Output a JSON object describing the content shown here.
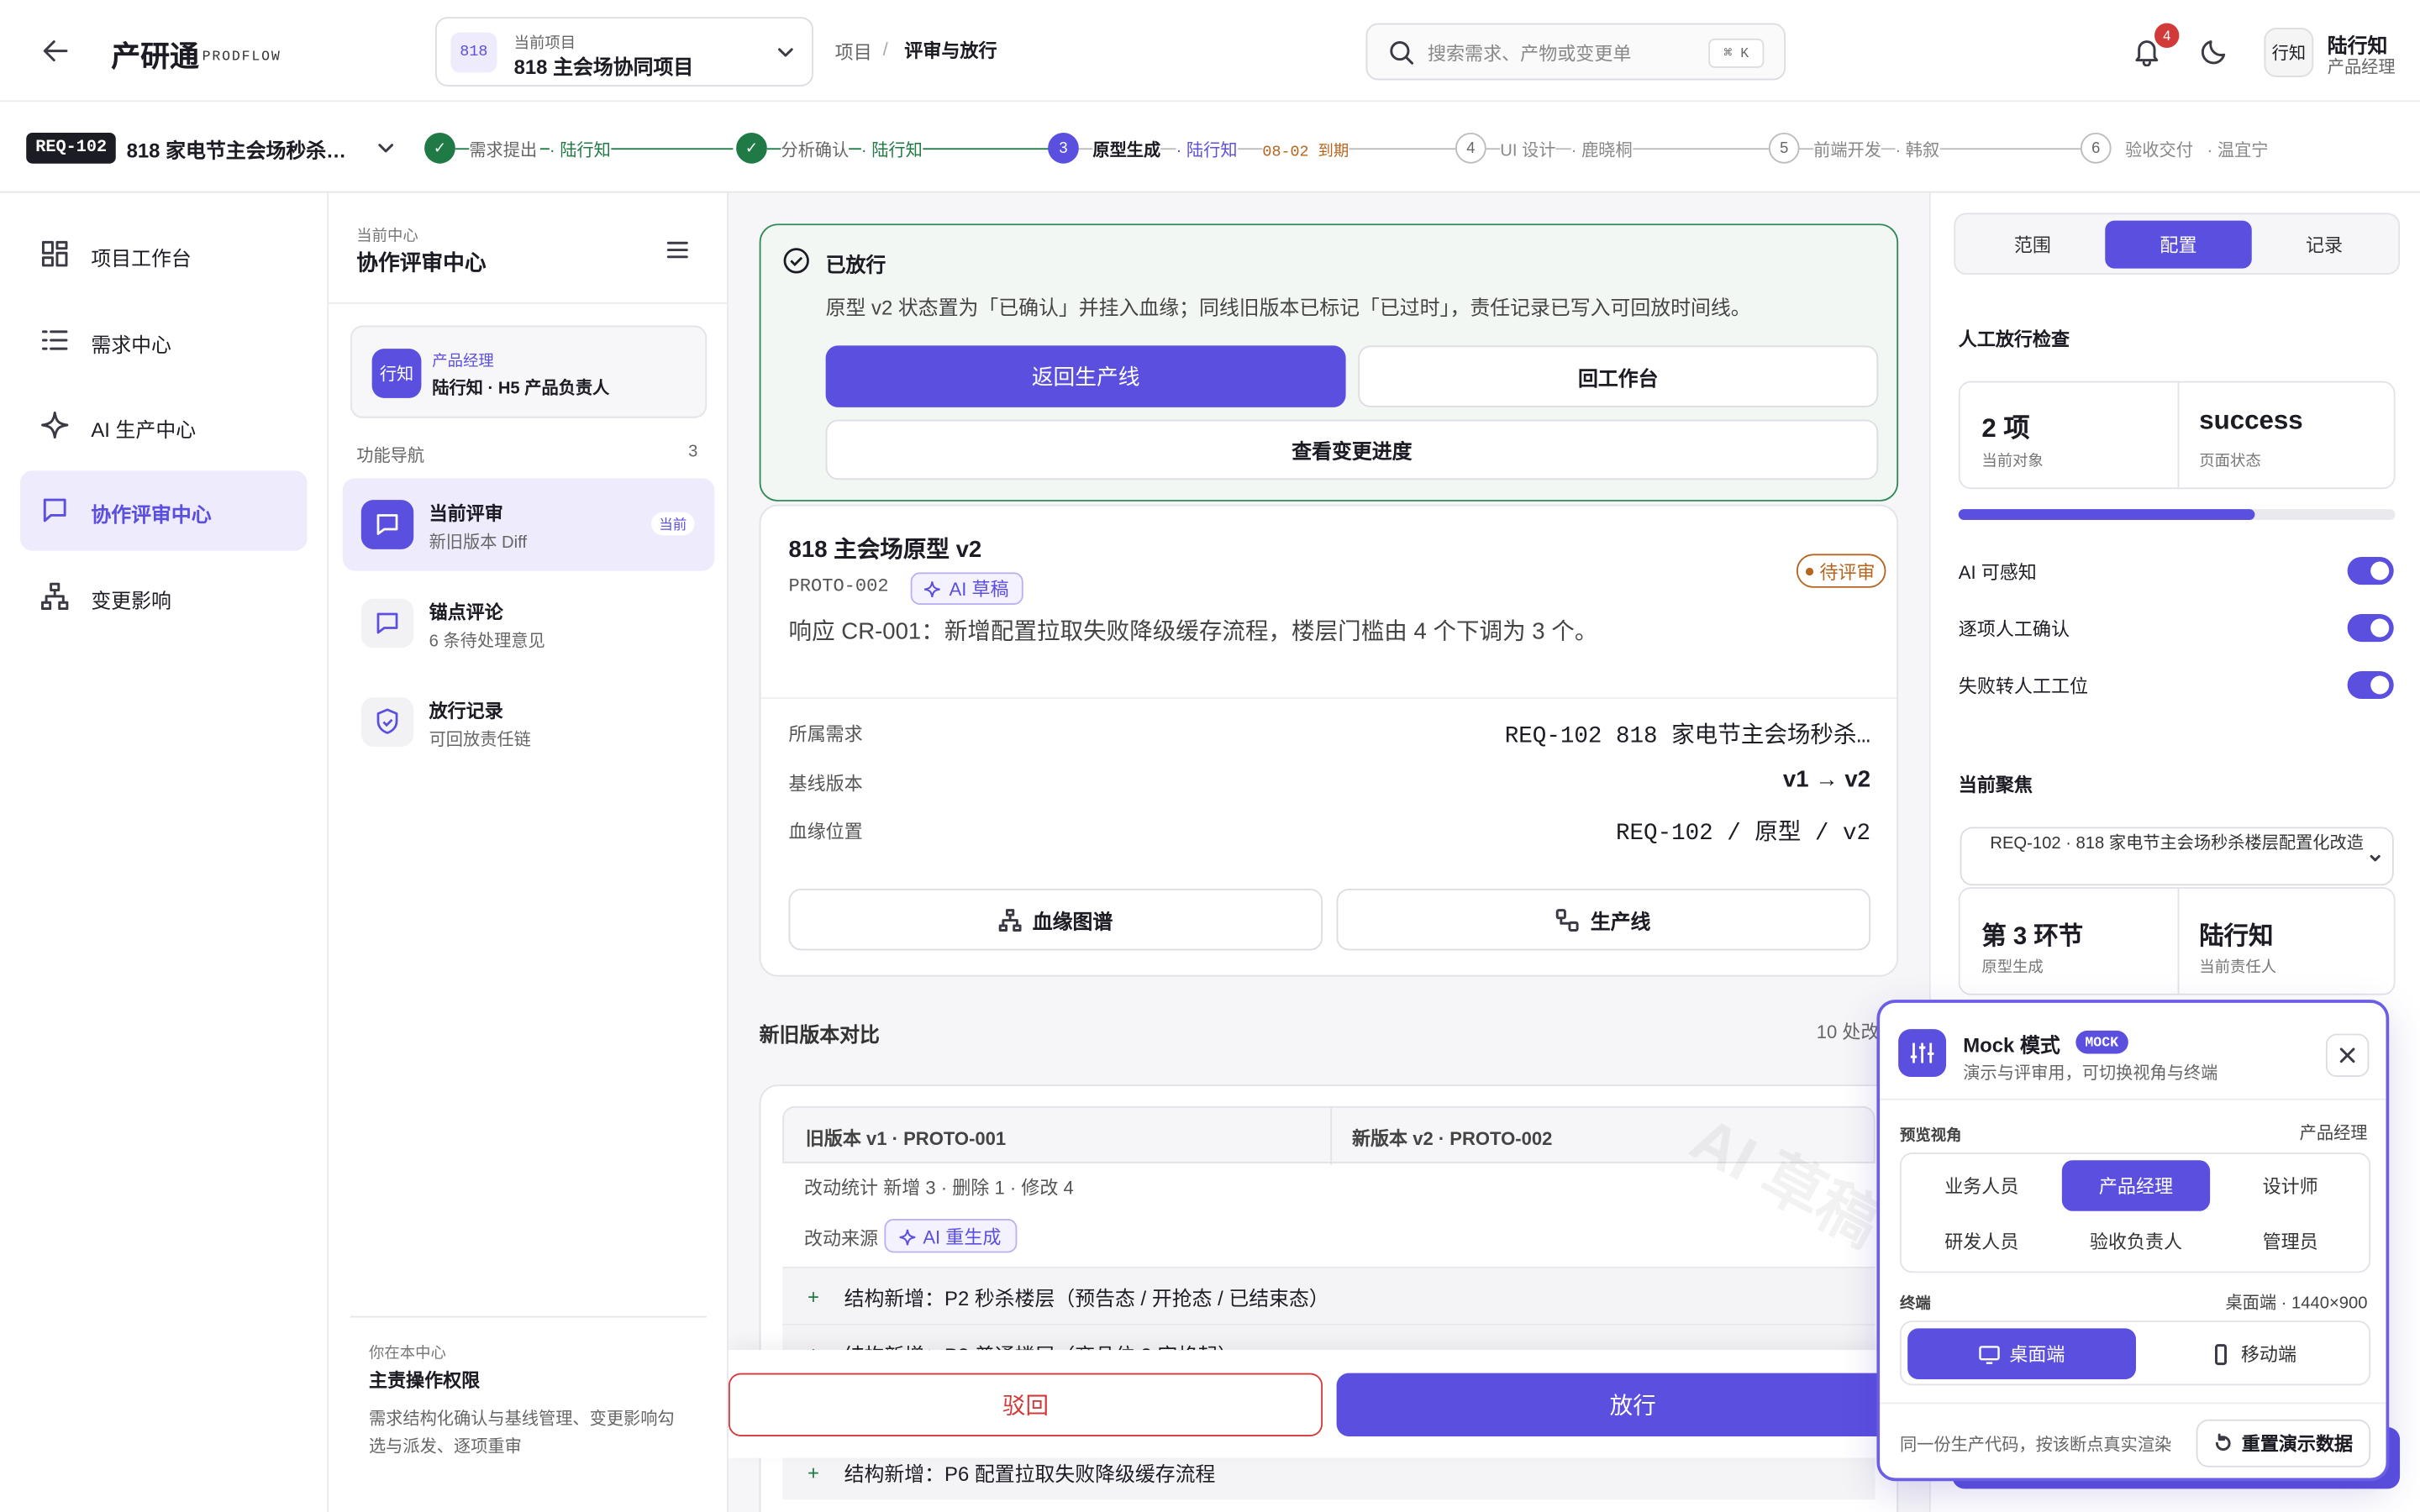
{
  "header": {
    "app_name": "产研通",
    "app_sub": "PRODFLOW",
    "project_badge": "818",
    "project_caption": "当前项目",
    "project_name": "818 主会场协同项目",
    "crumb_project": "项目",
    "crumb_sep": "/",
    "crumb_current": "评审与放行",
    "search_placeholder": "搜索需求、产物或变更单",
    "search_kbd": "⌘ K",
    "notif_count": "4",
    "avatar": "行知",
    "user_name": "陆行知",
    "user_role": "产品经理"
  },
  "stepbar": {
    "req_id": "REQ-102",
    "req_title": "818 家电节主会场秒杀…",
    "steps": [
      {
        "num": "✓",
        "name": "需求提出",
        "owner": "· 陆行知",
        "state": "done"
      },
      {
        "num": "✓",
        "name": "分析确认",
        "owner": "· 陆行知",
        "state": "done"
      },
      {
        "num": "3",
        "name": "原型生成",
        "owner": "· 陆行知",
        "due": "08-02 到期",
        "state": "current"
      },
      {
        "num": "4",
        "name": "UI 设计",
        "owner": "· 鹿晓桐",
        "state": "todo"
      },
      {
        "num": "5",
        "name": "前端开发",
        "owner": "· 韩叙",
        "state": "todo"
      },
      {
        "num": "6",
        "name": "验收交付",
        "owner": "· 温宜宁",
        "state": "todo"
      }
    ]
  },
  "sidebar": {
    "items": [
      {
        "label": "项目工作台"
      },
      {
        "label": "需求中心"
      },
      {
        "label": "AI 生产中心"
      },
      {
        "label": "协作评审中心"
      },
      {
        "label": "变更影响"
      }
    ]
  },
  "subnav": {
    "caption": "当前中心",
    "title": "协作评审中心",
    "user_avatar": "行知",
    "user_role": "产品经理",
    "user_desc": "陆行知 · H5 产品负责人",
    "section": "功能导航",
    "section_count": "3",
    "items": [
      {
        "title": "当前评审",
        "desc": "新旧版本 Diff",
        "badge": "当前"
      },
      {
        "title": "锚点评论",
        "desc": "6 条待处理意见"
      },
      {
        "title": "放行记录",
        "desc": "可回放责任链"
      }
    ],
    "footer_caption": "你在本中心",
    "footer_title": "主责操作权限",
    "footer_desc": "需求结构化确认与基线管理、变更影响勾选与派发、逐项重审"
  },
  "main": {
    "banner_title": "已放行",
    "banner_desc": "原型 v2 状态置为「已确认」并挂入血缘；同线旧版本已标记「已过时」，责任记录已写入可回放时间线。",
    "btn_back": "返回生产线",
    "btn_workbench": "回工作台",
    "btn_progress": "查看变更进度",
    "card_title": "818 主会场原型 v2",
    "card_code": "PROTO-002",
    "card_tag": "AI 草稿",
    "card_status": "待评审",
    "card_desc": "响应 CR-001：新增配置拉取失败降级缓存流程，楼层门槛由 4 个下调为 3 个。",
    "kv": [
      {
        "k": "所属需求",
        "v": "REQ-102 818 家电节主会场秒杀…"
      },
      {
        "k": "基线版本",
        "v": "v1 → v2"
      },
      {
        "k": "血缘位置",
        "v": "REQ-102 / 原型 / v2"
      }
    ],
    "btn_lineage": "血缘图谱",
    "btn_line": "生产线",
    "compare_title": "新旧版本对比",
    "compare_count": "10 处改",
    "old_head": "旧版本 v1 · PROTO-001",
    "new_head": "新版本 v2 · PROTO-002",
    "stats": "改动统计 新增 3 · 删除 1 · 修改 4",
    "source_label": "改动来源",
    "source_tag": "AI 重生成",
    "diff_rows": [
      "结构新增：P2 秒杀楼层（预告态 / 开抢态 / 已结束态）",
      "结构新增：P3 普通楼层（商品位 3 字格起）",
      "结构新增：P6 配置拉取失败降级缓存流程"
    ],
    "btn_reject": "驳回",
    "btn_release": "放行",
    "watermark": "AI 草稿"
  },
  "right": {
    "tabs": [
      "范围",
      "配置",
      "记录"
    ],
    "check_title": "人工放行检查",
    "stat1_v": "2 项",
    "stat1_l": "当前对象",
    "stat2_v": "success",
    "stat2_l": "页面状态",
    "progress": 0.68,
    "toggles": [
      "AI 可感知",
      "逐项人工确认",
      "失败转人工工位"
    ],
    "focus_title": "当前聚焦",
    "focus_select": "REQ-102 · 818 家电节主会场秒杀楼层配置化改造",
    "stage_v": "第 3 环节",
    "stage_l": "原型生成",
    "owner_v": "陆行知",
    "owner_l": "当前责任人"
  },
  "mock": {
    "title": "Mock 模式",
    "badge": "MOCK",
    "desc": "演示与评审用，可切换视角与终端",
    "view_label": "预览视角",
    "view_value": "产品经理",
    "roles": [
      "业务人员",
      "产品经理",
      "设计师",
      "研发人员",
      "验收负责人",
      "管理员"
    ],
    "term_label": "终端",
    "term_value": "桌面端 · 1440×900",
    "term_desktop": "桌面端",
    "term_mobile": "移动端",
    "foot": "同一份生产代码，按该断点真实渲染",
    "reset": "重置演示数据"
  },
  "colors": {
    "accent": "#5b4fe0",
    "success": "#1f7a45",
    "warning": "#b5651d",
    "danger": "#d23a3a"
  }
}
